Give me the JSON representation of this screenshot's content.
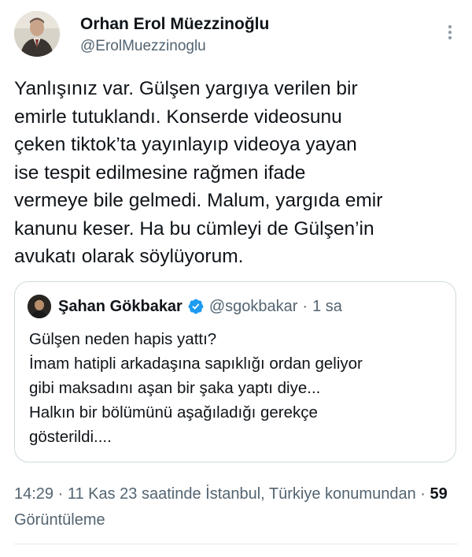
{
  "author": {
    "display_name": "Orhan Erol Müezzinoğlu",
    "handle": "@ErolMuezzinoglu",
    "avatar_icon": "person-portrait-avatar"
  },
  "more_icon": "more-vertical-icon",
  "tweet": {
    "text": "Yanlışınız var. Gülşen yargıya verilen bir\nemirle tutuklandı. Konserde videosunu\nçeken tiktok’ta yayınlayıp videoya yayan\nise tespit edilmesine rağmen ifade\nvermeye bile gelmedi. Malum, yargıda emir\nkanunu keser. Ha bu cümleyi de Gülşen’in\navukatı olarak söylüyorum."
  },
  "quoted_tweet": {
    "display_name": "Şahan Gökbakar",
    "verified": true,
    "verified_color": "#1d9bf0",
    "handle": "@sgokbakar",
    "separator": "·",
    "time": "1 sa",
    "text": "Gülşen neden hapis yattı?\nİmam hatipli arkadaşına sapıklığı ordan geliyor\ngibi maksadını aşan bir şaka yaptı diye...\nHalkın bir bölümünü aşağıladığı gerekçe\ngösterildi...."
  },
  "meta": {
    "time_location": "14:29 · 11 Kas 23 saatinde İstanbul, Türkiye konumundan",
    "separator": " · ",
    "views_count": "59",
    "views_label": " Görüntüleme"
  },
  "colors": {
    "text": "#0f1419",
    "secondary": "#536471",
    "border": "#cfd9de"
  }
}
